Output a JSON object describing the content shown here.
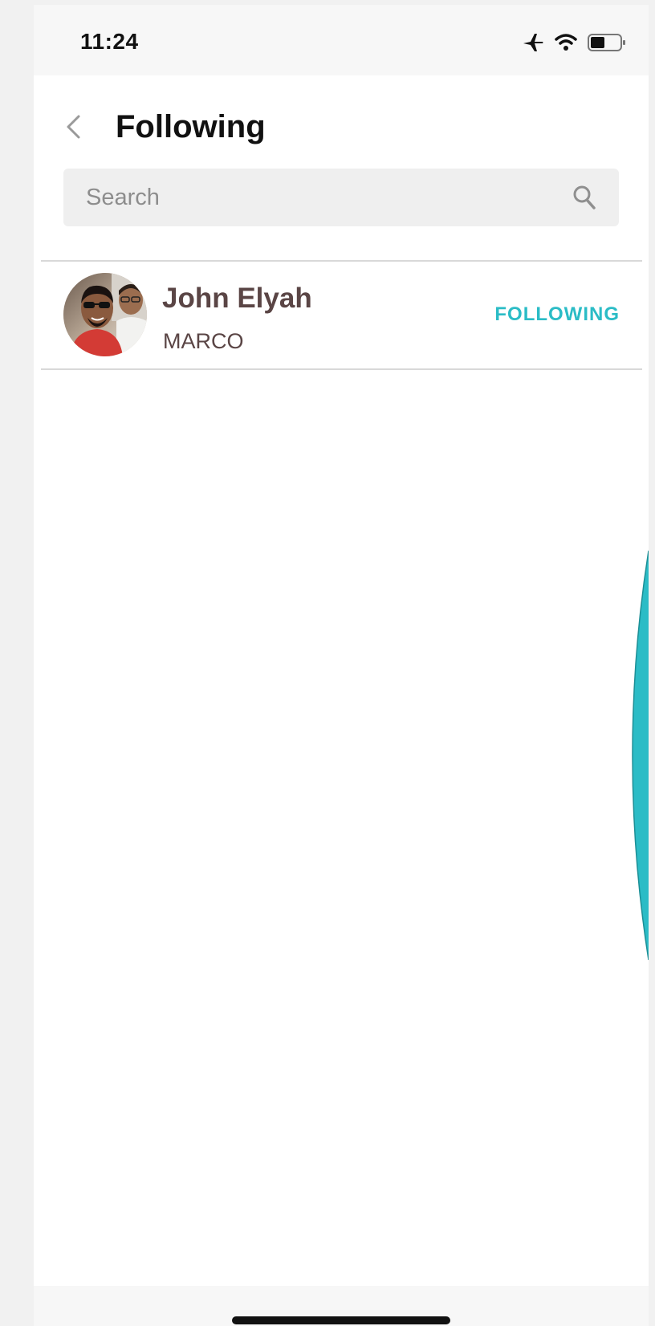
{
  "status_bar": {
    "time": "11:24",
    "icons": [
      "airplane-icon",
      "wifi-icon",
      "battery-icon"
    ]
  },
  "header": {
    "title": "Following",
    "back_icon": "chevron-left-icon"
  },
  "search": {
    "placeholder": "Search",
    "value": "",
    "icon": "search-icon"
  },
  "following_list": [
    {
      "name": "John Elyah",
      "handle": "MARCO",
      "action_label": "FOLLOWING",
      "avatar": "avatar-photo"
    }
  ],
  "colors": {
    "accent": "#2bbcc6",
    "name_text": "#5a4545",
    "search_bg": "#efefef",
    "divider": "#d9d9d9"
  }
}
